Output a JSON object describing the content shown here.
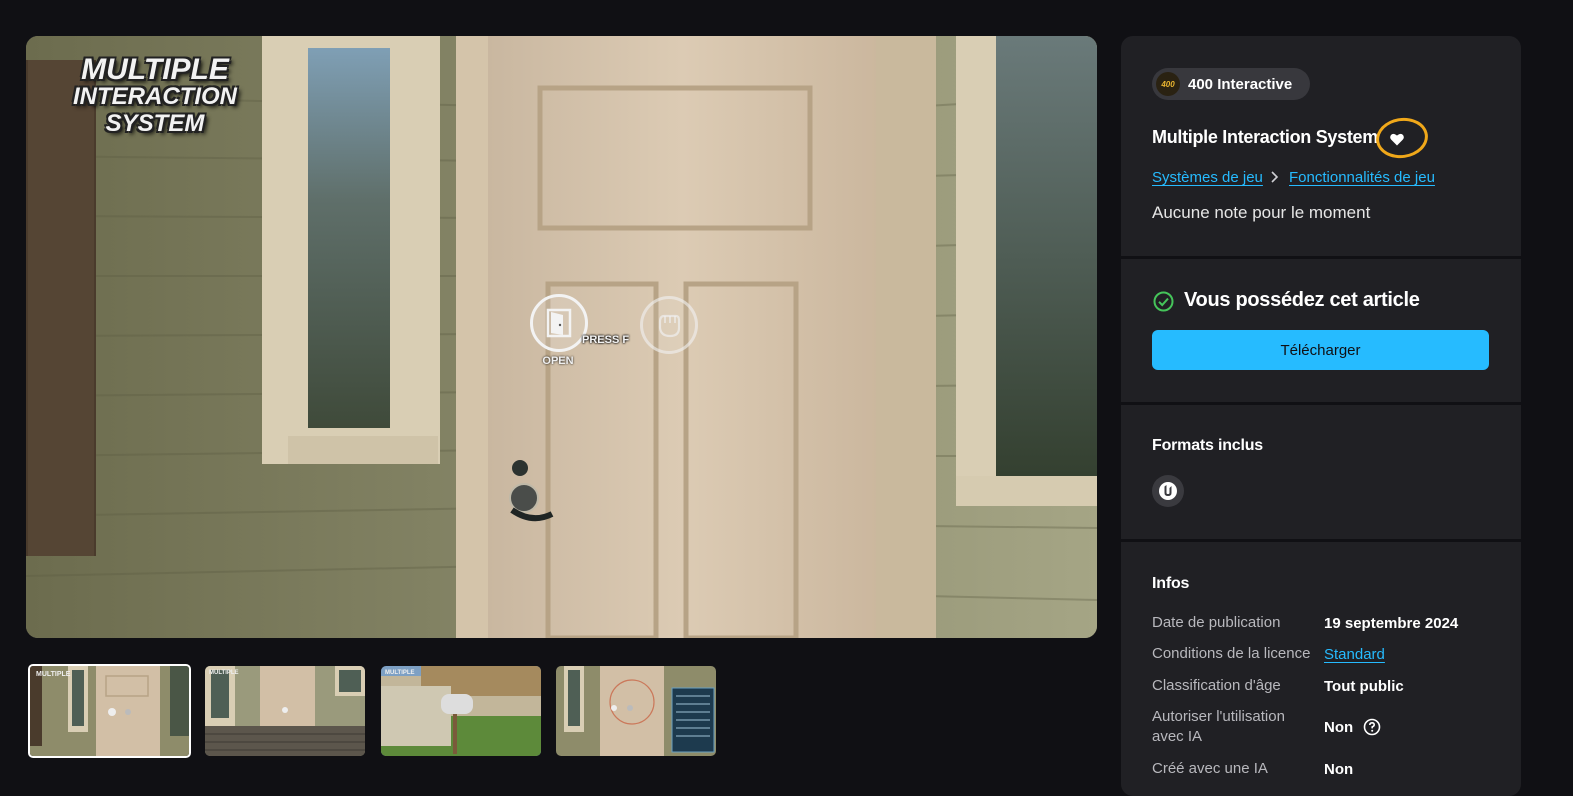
{
  "hero": {
    "logo_lines": [
      "MULTIPLE",
      "INTERACTION",
      "SYSTEM"
    ],
    "open_label": "OPEN",
    "press_label": "PRESS F"
  },
  "thumbnails": [
    {
      "name": "door-thumbnail",
      "active": true
    },
    {
      "name": "porch-thumbnail",
      "active": false
    },
    {
      "name": "mailbox-thumbnail",
      "active": false
    },
    {
      "name": "settings-thumbnail",
      "active": false
    }
  ],
  "publisher": {
    "logo_text": "400",
    "name": "400 Interactive"
  },
  "product": {
    "title": "Multiple Interaction System",
    "breadcrumb": [
      "Systèmes de jeu",
      "Fonctionnalités de jeu"
    ],
    "rating": "Aucune note pour le moment"
  },
  "ownership": {
    "text": "Vous possédez cet article",
    "download_label": "Télécharger"
  },
  "formats": {
    "heading": "Formats inclus",
    "items": [
      {
        "icon": "unreal-engine-icon"
      }
    ]
  },
  "infos": {
    "heading": "Infos",
    "rows": [
      {
        "label": "Date de publication",
        "value": "19 septembre 2024"
      },
      {
        "label": "Conditions de la licence",
        "value": "Standard"
      },
      {
        "label": "Classification d'âge",
        "value": "Tout public"
      },
      {
        "label": "Autoriser l'utilisation avec IA",
        "value": "Non"
      },
      {
        "label": "Créé avec une IA",
        "value": "Non"
      }
    ]
  },
  "colors": {
    "background": "#101014",
    "panel": "#202024",
    "accent": "#26bbff",
    "owned_green": "#45c45a",
    "annotation_ring": "#f0a81a"
  }
}
